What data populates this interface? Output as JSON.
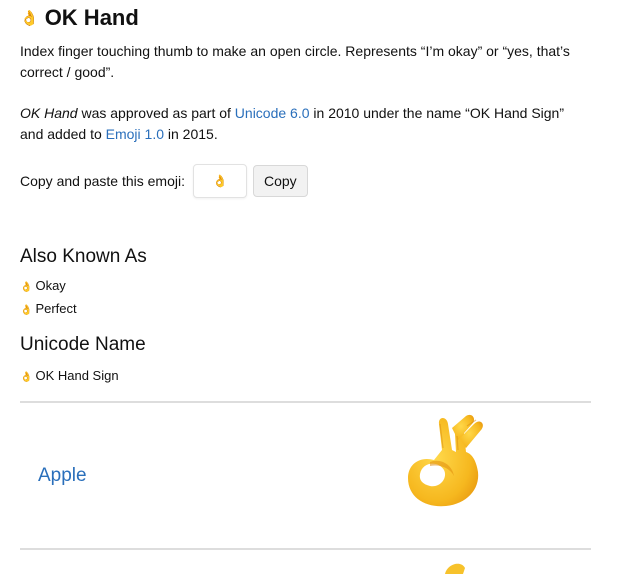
{
  "page": {
    "emoji_glyph": "👌",
    "title": "OK Hand",
    "description": "Index finger touching thumb to make an open circle. Represents “I’m okay” or “yes, that’s correct / good”.",
    "approval": {
      "name_italic": "OK Hand",
      "text_1": " was approved as part of ",
      "unicode_link": "Unicode 6.0",
      "text_2": " in 2010 under the name “OK Hand Sign” and added to ",
      "emoji_link": "Emoji 1.0",
      "text_3": " in 2015."
    }
  },
  "copy_section": {
    "label": "Copy and paste this emoji:",
    "emoji_value": "👌",
    "button_label": "Copy"
  },
  "also_known_as": {
    "heading": "Also Known As",
    "items": [
      {
        "glyph": "👌",
        "label": "Okay"
      },
      {
        "glyph": "👌",
        "label": "Perfect"
      }
    ]
  },
  "unicode_name": {
    "heading": "Unicode Name",
    "items": [
      {
        "glyph": "👌",
        "label": "OK Hand Sign"
      }
    ]
  },
  "vendors": [
    {
      "name": "Apple"
    }
  ],
  "colors": {
    "link": "#2a6fbb",
    "emoji_skin": "#f7c22b",
    "divider": "#dddddd"
  }
}
